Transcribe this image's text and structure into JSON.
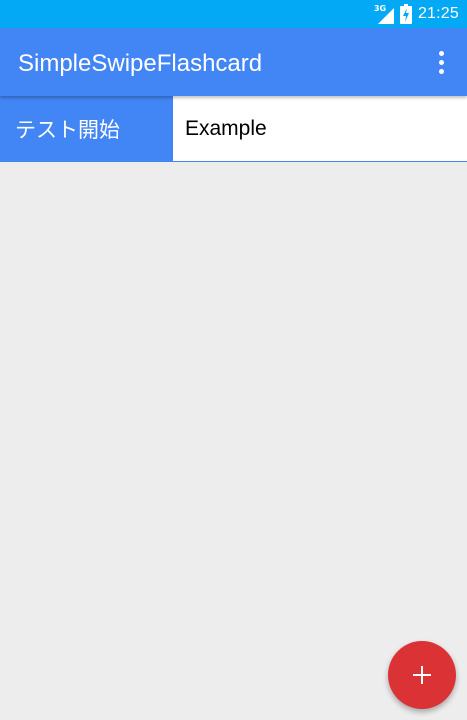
{
  "status_bar": {
    "network_type": "3G",
    "time": "21:25",
    "icons": [
      "signal-icon",
      "battery-charging-icon"
    ],
    "color": "#03a9f4"
  },
  "app_bar": {
    "title": "SimpleSwipeFlashcard",
    "overflow_icon": "more-vert-icon",
    "color": "#4285f4"
  },
  "deck_row": {
    "start_test_label": "テスト開始",
    "deck_name": "Example"
  },
  "fab": {
    "icon": "plus-icon",
    "color": "#db3236"
  },
  "colors": {
    "background": "#eeedee",
    "accent": "#4285f4"
  }
}
